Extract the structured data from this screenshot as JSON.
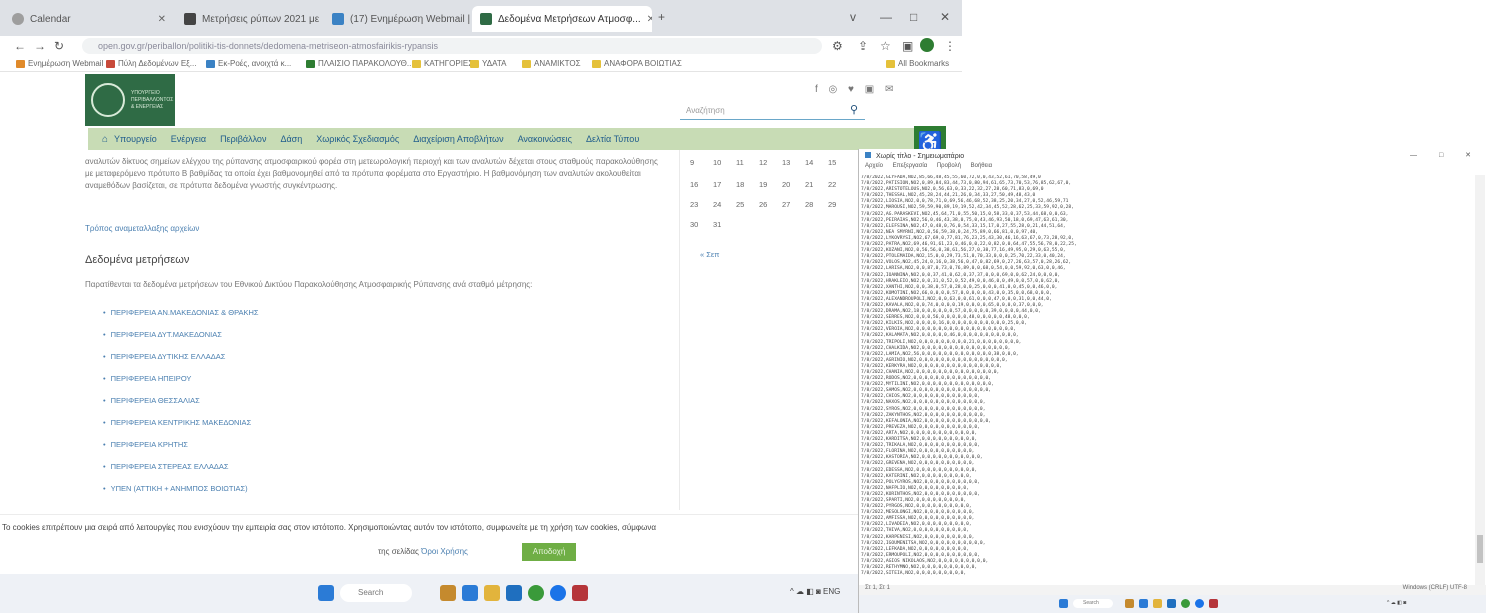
{
  "browser": {
    "tabs": [
      {
        "label": "Calendar",
        "icon": "calendar-icon",
        "color": "#9e9e9e"
      },
      {
        "label": "Μετρήσεις ρύπων 2021 με άλλ...",
        "icon": "t-icon",
        "color": "#444444"
      },
      {
        "label": "(17) Ενημέρωση Webmail | Fac...",
        "icon": "webmail-icon",
        "color": "#3b82c4"
      },
      {
        "label": "Δεδομένα Μετρήσεων Ατμοσφ...",
        "icon": "page-icon",
        "color": "#2f6b45"
      }
    ],
    "new_tab": "+",
    "window_controls": [
      "v",
      "—",
      "□",
      "✕"
    ],
    "url": "open.gov.gr/periballon/politiki-tis-donnets/dedomena-metriseon-atmosfairikis-rypansis",
    "bookmarks": [
      {
        "label": "Ενημέρωση Webmail",
        "color": "#e08a2a"
      },
      {
        "label": "Πύλη Δεδομένων Εξ...",
        "color": "#c84a3a"
      },
      {
        "label": "Εκ-Ροές, ανοιχτά κ...",
        "color": "#3b82c4"
      },
      {
        "label": "ΠΛΑΙΣΙΟ ΠΑΡΑΚΟΛΟΥΘ...",
        "color": "#2e7d32"
      },
      {
        "label": "ΚΑΤΗΓΟΡΙΕΣ",
        "color": "#e5c13a"
      },
      {
        "label": "ΥΔΑΤΑ",
        "color": "#e5c13a"
      },
      {
        "label": "ΑΝΑΜΙΚΤΟΣ",
        "color": "#e5c13a"
      },
      {
        "label": "ΑΝΑΦΟΡΑ ΒΟΙΩΤΙΑΣ",
        "color": "#e5c13a"
      },
      {
        "label": "All Bookmarks",
        "color": "#e5c13a"
      }
    ]
  },
  "site": {
    "logo_text": "ΥΠΟΥΡΓΕΙΟ ΠΕΡΙΒΑΛΛΟΝΤΟΣ & ΕΝΕΡΓΕΙΑΣ",
    "social_icons": "f ◎ ♥ ▣ ✉",
    "search_placeholder": "Αναζήτηση",
    "menu": [
      "Υπουργείο",
      "Ενέργεια",
      "Περιβάλλον",
      "Δάση",
      "Χωρικός Σχεδιασμός",
      "Διαχείριση Αποβλήτων",
      "Ανακοινώσεις",
      "Δελτία Τύπου"
    ],
    "paragraph": "αναλυτών δίκτυος σημείων ελέγχου της ρύπανσης ατμοσφαιρικού φορέα στη μετεωρολογική περιοχή και των αναλυτών δέχεται στους σταθμούς παρακολούθησης με μεταφερόμενο πρότυπο Β βαθμίδας τα οποία έχει βαθμονομηθεί από τα πρότυπα φορέματα στο Εργαστήριο. Η βαθμονόμηση των αναλυτών ακολουθείται αναμεθόδων βασίζεται, σε πρότυπα δεδομένα γνωστής συγκέντρωσης.",
    "small_link": "Τρόπος αναμεταλλαξης αρχείων",
    "heading": "Δεδομένα μετρήσεων",
    "intro": "Παρατίθενται τα δεδομένα μετρήσεων του Εθνικού Δικτύου Παρακολούθησης Ατμοσφαιρικής Ρύπανσης ανά σταθμό μέτρησης:",
    "regions": [
      "ΠΕΡΙΦΕΡΕΙΑ ΑΝ.ΜΑΚΕΔΟΝΙΑΣ & ΘΡΑΚΗΣ",
      "ΠΕΡΙΦΕΡΕΙΑ ΔΥΤ.ΜΑΚΕΔΟΝΙΑΣ",
      "ΠΕΡΙΦΕΡΕΙΑ ΔΥΤΙΚΗΣ ΕΛΛΑΔΑΣ",
      "ΠΕΡΙΦΕΡΕΙΑ ΗΠΕΙΡΟΥ",
      "ΠΕΡΙΦΕΡΕΙΑ ΘΕΣΣΑΛΙΑΣ",
      "ΠΕΡΙΦΕΡΕΙΑ ΚΕΝΤΡΙΚΗΣ ΜΑΚΕΔΟΝΙΑΣ",
      "ΠΕΡΙΦΕΡΕΙΑ ΚΡΗΤΗΣ",
      "ΠΕΡΙΦΕΡΕΙΑ ΣΤΕΡΕΑΣ ΕΛΛΑΔΑΣ",
      "ΥΠΕΝ (ΑΤΤΙΚΗ + ΑΝΗΜΠΟΣ ΒΟΙΩΤΙΑΣ)"
    ],
    "calendar": [
      [
        "9",
        "10",
        "11",
        "12",
        "13",
        "14",
        "15"
      ],
      [
        "16",
        "17",
        "18",
        "19",
        "20",
        "21",
        "22"
      ],
      [
        "23",
        "24",
        "25",
        "26",
        "27",
        "28",
        "29"
      ],
      [
        "30",
        "31"
      ]
    ],
    "calendar_prev": "« Σεπ",
    "cookie_text": "Το cookies επιτρέπουν μια σειρά από λειτουργίες που ενισχύουν την εμπειρία σας στον ιστότοπο. Χρησιμοποιώντας αυτόν τον ιστότοπο, συμφωνείτε με τη χρήση των cookies, σύμφωνα",
    "cookie_more_prefix": "της σελίδας",
    "cookie_more_link": "Όροι Χρήσης",
    "cookie_button": "Αποδοχή",
    "taskbar_search": "Search",
    "taskbar_tray": "^ ☁ ◧ ◙  ENG"
  },
  "notepad": {
    "title": "Χωρίς τίτλο - Σημειωματάριο",
    "window_controls": "— □ ✕",
    "menu": [
      "Αρχείο",
      "Επεξεργασία",
      "Προβολή",
      "Βοήθεια"
    ],
    "status_left": "Στ 1, Στ 1",
    "status_right": "Windows (CRLF)   UTF-8",
    "taskbar_search": "Search",
    "lines": [
      "7/8/2022,GLYFADA,NO2,85,66,48,45,55,60,72,0,0,43,52,61,70,58,49,0",
      "7/8/2022,PATISION,NO2,0,89,84,83,44,73,0,80,94,61,65,73,70,53,76,85,62,67,0,",
      "7/8/2022,ARISTOTELOUS,NO2,0,56,63,0,33,22,32,27,28,60,71,83,0,69,0",
      "7/8/2022,THESSAL,NO2,45,28,24,44,21,26,0,34,33,27,50,49,48,43,0",
      "7/8/2022,LIOSIA,NO2,0,0,78,71,0,69,56,46,68,52,38,25,20,34,27,0,52,46,59,71",
      "7/8/2022,MAROUSI,NO2,59,59,90,89,19,19,52,42,34,45,52,28,62,25,33,59,92,0,28,",
      "7/8/2022,AG.PARASKEVI,NO2,45,64,71,0,55,50,15,0,58,33,0,37,53,44,68,0,0,63,",
      "7/8/2022,PEIRAIAS,NO2,56,0,46,43,38,0,75,0,43,46,93,50,18,0,69,47,63,61,30,",
      "7/8/2022,ELEFSINA,NO2,47,0,48,0,76,0,54,33,15,17,0,27,55,28,0,21,44,51,64,",
      "7/8/2022,NEA SMYRNI,NO2,0,56,59,38,0,24,75,89,0,66,81,0,0,97,40,",
      "7/8/2022,LYKOVRYSI,NO2,67,69,0,77,81,76,23,25,43,30,46,16,63,67,0,73,28,92,0,",
      "7/8/2022,PATRA,NO2,69,46,91,61,23,0,46,0,0,22,0,82,0,0,64,47,55,56,78,0,22,25,",
      "7/8/2022,KOZANI,NO2,0,56,56,0,38,61,56,27,0,38,77,16,49,95,0,29,0,63,55,0,",
      "7/8/2022,PTOLEMAIDA,NO2,15,0,0,29,73,51,0,70,33,0,0,0,25,70,22,33,0,40,24,",
      "7/8/2022,VOLOS,NO2,45,24,0,16,0,38,56,0,47,0,82,69,0,27,26,63,57,0,28,26,62,",
      "7/8/2022,LARISA,NO2,0,0,87,0,73,0,76,89,0,0,68,0,54,0,0,59,92,0,63,0,0,46,",
      "7/8/2022,IOANNINA,NO2,0,0,37,41,0,62,0,37,37,0,0,0,69,0,0,62,24,0,0,0,0,",
      "7/8/2022,HRAKLEIO,NO2,0,0,31,0,52,0,52,49,0,0,46,0,0,49,0,0,57,0,0,62,0,",
      "7/8/2022,XANTHI,NO2,0,0,38,0,57,0,28,0,0,25,0,0,0,41,0,0,45,0,0,46,0,0,",
      "7/8/2022,KOMOTINI,NO2,66,0,0,0,0,57,0,0,0,0,0,43,0,0,35,0,0,68,0,0,0,",
      "7/8/2022,ALEXANDROUPOLI,NO2,0,0,63,0,0,61,0,0,0,47,0,0,0,31,0,0,44,0,",
      "7/8/2022,KAVALA,NO2,0,0,74,0,0,0,0,19,0,0,0,0,65,0,0,0,0,37,0,0,0,",
      "7/8/2022,DRAMA,NO2,18,0,0,0,0,0,0,57,0,0,0,0,0,39,0,0,0,0,44,0,0,",
      "7/8/2022,SERRES,NO2,0,0,0,56,0,0,0,0,0,48,0,0,0,0,0,48,0,0,0,",
      "7/8/2022,KILKIS,NO2,0,0,0,0,16,0,0,0,0,0,0,0,0,0,0,0,25,0,0,",
      "7/8/2022,VEROIA,NO2,0,0,0,0,0,0,0,0,0,0,0,0,0,0,0,0,0,0,",
      "7/8/2022,KALAMATA,NO2,0,0,0,0,0,46,0,0,0,0,0,0,0,0,0,0,0,",
      "7/8/2022,TRIPOLI,NO2,0,0,0,0,0,0,0,0,0,21,0,0,0,0,0,0,0,0,",
      "7/8/2022,CHALKIDA,NO2,0,0,0,0,0,0,0,0,0,0,0,0,0,0,0,0,",
      "7/8/2022,LAMIA,NO2,56,0,0,0,0,0,0,0,0,0,0,0,0,0,38,0,0,0,",
      "7/8/2022,AGRINIO,NO2,0,0,0,0,0,0,0,0,0,0,0,0,0,0,0,0,",
      "7/8/2022,KERKYRA,NO2,0,0,0,0,0,0,0,0,0,0,0,0,0,0,0,",
      "7/8/2022,CHANIA,NO2,0,0,0,0,0,0,0,0,0,0,0,0,0,0,0,",
      "7/8/2022,RODOS,NO2,0,0,0,0,0,0,0,0,0,0,0,0,0,0,",
      "7/8/2022,MYTILINI,NO2,0,0,0,0,0,0,0,0,0,0,0,0,0,",
      "7/8/2022,SAMOS,NO2,0,0,0,0,0,0,0,0,0,0,0,0,0,0,",
      "7/8/2022,CHIOS,NO2,0,0,0,0,0,0,0,0,0,0,0,0,",
      "7/8/2022,NAXOS,NO2,0,0,0,0,0,0,0,0,0,0,0,0,0,",
      "7/8/2022,SYROS,NO2,0,0,0,0,0,0,0,0,0,0,0,0,0,",
      "7/8/2022,ZAKYNTHOS,NO2,0,0,0,0,0,0,0,0,0,0,0,",
      "7/8/2022,KEFALONIA,NO2,0,0,0,0,0,0,0,0,0,0,0,0,",
      "7/8/2022,PREVEZA,NO2,0,0,0,0,0,0,0,0,0,0,0,",
      "7/8/2022,ARTA,NO2,0,0,0,0,0,0,0,0,0,0,0,0,",
      "7/8/2022,KARDITSA,NO2,0,0,0,0,0,0,0,0,0,0,",
      "7/8/2022,TRIKALA,NO2,0,0,0,0,0,0,0,0,0,0,0,",
      "7/8/2022,FLORINA,NO2,0,0,0,0,0,0,0,0,0,0,",
      "7/8/2022,KASTORIA,NO2,0,0,0,0,0,0,0,0,0,0,0,",
      "7/8/2022,GREVENA,NO2,0,0,0,0,0,0,0,0,0,0,",
      "7/8/2022,EDESSA,NO2,0,0,0,0,0,0,0,0,0,0,0,",
      "7/8/2022,KATERINI,NO2,0,0,0,0,0,0,0,0,0,",
      "7/8/2022,POLYGYROS,NO2,0,0,0,0,0,0,0,0,0,0,",
      "7/8/2022,NAFPLIO,NO2,0,0,0,0,0,0,0,0,0,",
      "7/8/2022,KORINTHOS,NO2,0,0,0,0,0,0,0,0,0,0,",
      "7/8/2022,SPARTI,NO2,0,0,0,0,0,0,0,0,0,",
      "7/8/2022,PYRGOS,NO2,0,0,0,0,0,0,0,0,0,0,",
      "7/8/2022,MESOLONGI,NO2,0,0,0,0,0,0,0,0,0,",
      "7/8/2022,AMFISSA,NO2,0,0,0,0,0,0,0,0,0,0,",
      "7/8/2022,LIVADEIA,NO2,0,0,0,0,0,0,0,0,0,",
      "7/8/2022,THIVA,NO2,0,0,0,0,0,0,0,0,0,0,",
      "7/8/2022,KARPENISI,NO2,0,0,0,0,0,0,0,0,0,",
      "7/8/2022,IGOUMENITSA,NO2,0,0,0,0,0,0,0,0,0,0,",
      "7/8/2022,LEFKADA,NO2,0,0,0,0,0,0,0,0,0,",
      "7/8/2022,ERMOUPOLI,NO2,0,0,0,0,0,0,0,0,0,0,",
      "7/8/2022,AGIOS NIKOLAOS,NO2,0,0,0,0,0,0,0,0,0,",
      "7/8/2022,RETHYMNO,NO2,0,0,0,0,0,0,0,0,0,0,",
      "7/8/2022,SITEIA,NO2,0,0,0,0,0,0,0,0,0,"
    ]
  }
}
